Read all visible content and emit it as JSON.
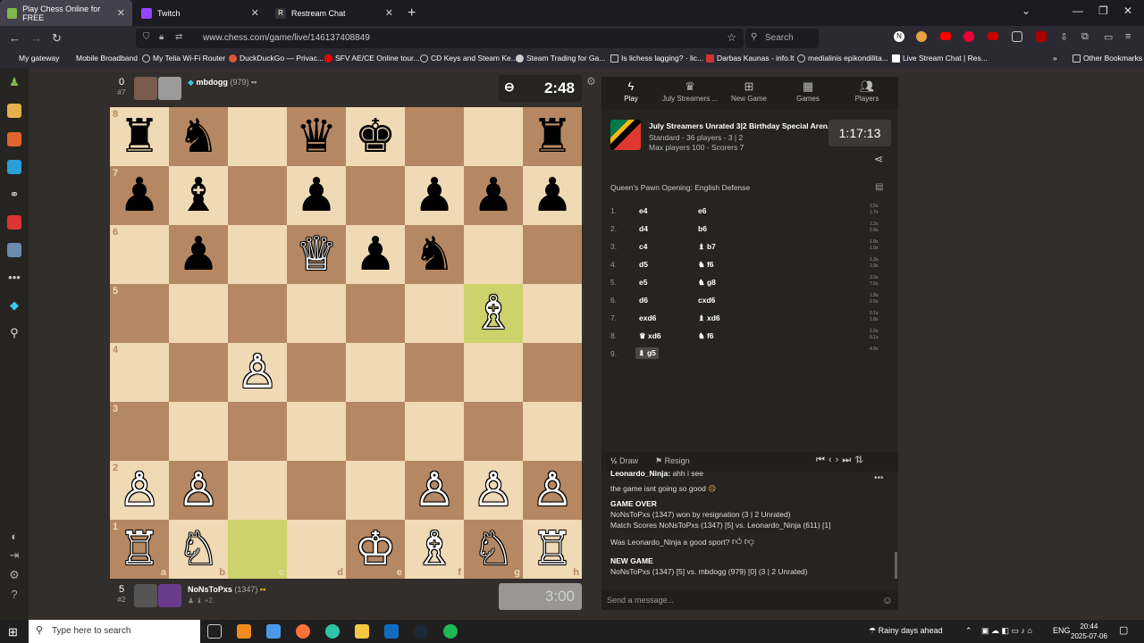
{
  "browser": {
    "tabs": [
      {
        "label": "Play Chess Online for FREE",
        "color": "#81b64c"
      },
      {
        "label": "Twitch",
        "color": "#9146ff"
      },
      {
        "label": "Restream Chat",
        "color": "#ffffff"
      }
    ],
    "url": "www.chess.com/game/live/146137408849",
    "search_placeholder": "Search",
    "bookmarks": [
      "My gateway",
      "Mobile Broadband",
      "My Telia Wi-Fi Router",
      "DuckDuckGo — Privac...",
      "SFV AE/CE Online tour...",
      "CD Keys and Steam Ke...",
      "Steam Trading for Ga...",
      "Is lichess lagging? · lic...",
      "Darbas Kaunas - info.lt",
      "medialinis epikondilita...",
      "Live Stream Chat | Res...",
      "Other Bookmarks"
    ]
  },
  "top_player": {
    "score": "0",
    "rank": "#7",
    "name": "mbdogg",
    "rating": "(979)",
    "clock": "2:48"
  },
  "bottom_player": {
    "score": "5",
    "rank": "#2",
    "name": "NoNsToPxs",
    "rating": "(1347)",
    "extra": "+2",
    "clock": "3:00"
  },
  "board": {
    "files": [
      "a",
      "b",
      "c",
      "d",
      "e",
      "f",
      "g",
      "h"
    ],
    "ranks": [
      "8",
      "7",
      "6",
      "5",
      "4",
      "3",
      "2",
      "1"
    ],
    "highlight": [
      "c1",
      "g5"
    ],
    "pieces": [
      {
        "sq": "a8",
        "p": "♜",
        "c": "b"
      },
      {
        "sq": "b8",
        "p": "♞",
        "c": "b"
      },
      {
        "sq": "d8",
        "p": "♛",
        "c": "b"
      },
      {
        "sq": "e8",
        "p": "♚",
        "c": "b"
      },
      {
        "sq": "h8",
        "p": "♜",
        "c": "b"
      },
      {
        "sq": "a7",
        "p": "♟",
        "c": "b"
      },
      {
        "sq": "b7",
        "p": "♝",
        "c": "b"
      },
      {
        "sq": "d7",
        "p": "♟",
        "c": "b"
      },
      {
        "sq": "f7",
        "p": "♟",
        "c": "b"
      },
      {
        "sq": "g7",
        "p": "♟",
        "c": "b"
      },
      {
        "sq": "h7",
        "p": "♟",
        "c": "b"
      },
      {
        "sq": "b6",
        "p": "♟",
        "c": "b"
      },
      {
        "sq": "d6",
        "p": "♕",
        "c": "w"
      },
      {
        "sq": "e6",
        "p": "♟",
        "c": "b"
      },
      {
        "sq": "f6",
        "p": "♞",
        "c": "b"
      },
      {
        "sq": "g5",
        "p": "♗",
        "c": "w"
      },
      {
        "sq": "c4",
        "p": "♙",
        "c": "w"
      },
      {
        "sq": "a2",
        "p": "♙",
        "c": "w"
      },
      {
        "sq": "b2",
        "p": "♙",
        "c": "w"
      },
      {
        "sq": "f2",
        "p": "♙",
        "c": "w"
      },
      {
        "sq": "g2",
        "p": "♙",
        "c": "w"
      },
      {
        "sq": "h2",
        "p": "♙",
        "c": "w"
      },
      {
        "sq": "a1",
        "p": "♖",
        "c": "w"
      },
      {
        "sq": "b1",
        "p": "♘",
        "c": "w"
      },
      {
        "sq": "e1",
        "p": "♔",
        "c": "w"
      },
      {
        "sq": "f1",
        "p": "♗",
        "c": "w"
      },
      {
        "sq": "g1",
        "p": "♘",
        "c": "w"
      },
      {
        "sq": "h1",
        "p": "♖",
        "c": "w"
      }
    ]
  },
  "side_tabs": [
    "Play",
    "July Streamers ...",
    "New Game",
    "Games",
    "Players"
  ],
  "tournament": {
    "title": "July Streamers Unrated 3|2 Birthday Special Aren...",
    "line1": "Standard - 36 players - 3 | 2",
    "line2": "Max players 100 - Scorers 7",
    "clock": "1:17:13"
  },
  "opening": "Queen's Pawn Opening: English Defense",
  "moves": [
    {
      "n": "1.",
      "w": "e4",
      "b": "e6",
      "tw": "2.5s",
      "tb": "1.7s"
    },
    {
      "n": "2.",
      "w": "d4",
      "b": "b6",
      "tw": "1.2s",
      "tb": "0.9s"
    },
    {
      "n": "3.",
      "w": "c4",
      "b": "♝ b7",
      "tw": "1.8s",
      "tb": "1.0s"
    },
    {
      "n": "4.",
      "w": "d5",
      "b": "♞ f6",
      "tw": "1.3s",
      "tb": "1.9s"
    },
    {
      "n": "5.",
      "w": "e5",
      "b": "♞ g8",
      "tw": "2.0s",
      "tb": "7.6s"
    },
    {
      "n": "6.",
      "w": "d6",
      "b": "cxd6",
      "tw": "1.8s",
      "tb": "2.5s"
    },
    {
      "n": "7.",
      "w": "exd6",
      "b": "♝ xd6",
      "tw": "0.1s",
      "tb": "1.8s"
    },
    {
      "n": "8.",
      "w": "♛ xd6",
      "b": "♞ f6",
      "tw": "1.6s",
      "tb": "9.1s"
    },
    {
      "n": "9.",
      "w": "♝ g5",
      "b": "",
      "tw": "4.8s",
      "tb": ""
    }
  ],
  "actions": {
    "draw": "Draw",
    "resign": "Resign",
    "half": "½"
  },
  "chat": {
    "l1_name": "Leonardo_Ninja:",
    "l1_text": "ahh i see",
    "l2": "the game isnt going so good",
    "game_over": "GAME OVER",
    "result": "NoNsToPxs (1347) won by resignation (3 | 2 Unrated)",
    "match_prefix": "Match Scores",
    "match": "NoNsToPxs (1347) [5] vs. Leonardo_Ninja (611) [1]",
    "sport_q": "Was Leonardo_Ninja a good sport?",
    "new_game": "NEW GAME",
    "new_game_line": "NoNsToPxs (1347) [5] vs. mbdogg (979) [0] (3 | 2 Unrated)",
    "input_placeholder": "Send a message..."
  },
  "taskbar": {
    "search": "Type here to search",
    "weather": "Rainy days ahead",
    "lang": "ENG",
    "time": "20:44",
    "date": "2025-07-06"
  }
}
